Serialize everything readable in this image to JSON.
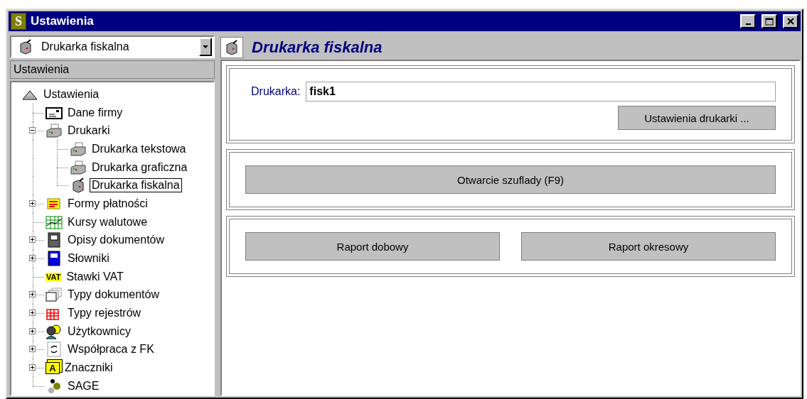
{
  "window": {
    "app_icon": "S",
    "title": "Ustawienia"
  },
  "sidebar": {
    "combo": {
      "value": "Drukarka fiskalna",
      "kind": "fiscal"
    },
    "header": "Ustawienia",
    "tree": [
      {
        "label": "Ustawienia",
        "kind": "root",
        "selected": false,
        "children": [
          {
            "label": "Dane firmy",
            "kind": "card",
            "selected": false
          },
          {
            "label": "Drukarki",
            "kind": "printer",
            "selected": false,
            "expanded": true,
            "children": [
              {
                "label": "Drukarka tekstowa",
                "kind": "printer",
                "selected": false
              },
              {
                "label": "Drukarka graficzna",
                "kind": "printer",
                "selected": false
              },
              {
                "label": "Drukarka fiskalna",
                "kind": "fiscal",
                "selected": true
              }
            ]
          },
          {
            "label": "Formy płatności",
            "kind": "payment",
            "selected": false,
            "expanded": false
          },
          {
            "label": "Kursy walutowe",
            "kind": "currency",
            "selected": false
          },
          {
            "label": "Opisy dokumentów",
            "kind": "device",
            "selected": false,
            "expanded": false
          },
          {
            "label": "Słowniki",
            "kind": "dictionary",
            "selected": false,
            "expanded": false
          },
          {
            "label": "Stawki VAT",
            "kind": "vat",
            "icon_text": "VAT",
            "selected": false
          },
          {
            "label": "Typy dokumentów",
            "kind": "pages",
            "selected": false,
            "expanded": false
          },
          {
            "label": "Typy rejestrów",
            "kind": "grid",
            "selected": false,
            "expanded": false
          },
          {
            "label": "Użytkownicy",
            "kind": "users",
            "selected": false,
            "expanded": false
          },
          {
            "label": "Współpraca z FK",
            "kind": "sync",
            "selected": false,
            "expanded": false
          },
          {
            "label": "Znaczniki",
            "kind": "tag",
            "icon_text": "A",
            "selected": false,
            "expanded": false
          },
          {
            "label": "SAGE",
            "kind": "sage",
            "selected": false
          }
        ]
      }
    ]
  },
  "content": {
    "title": "Drukarka fiskalna",
    "kind": "fiscal",
    "sections": [
      {
        "kind": "field",
        "label": "Drukarka:",
        "value": "fisk1",
        "button": "Ustawienia drukarki ..."
      },
      {
        "kind": "buttons",
        "buttons": [
          "Otwarcie szuflady (F9)"
        ]
      },
      {
        "kind": "buttons",
        "buttons": [
          "Raport dobowy",
          "Raport okresowy"
        ]
      }
    ]
  }
}
